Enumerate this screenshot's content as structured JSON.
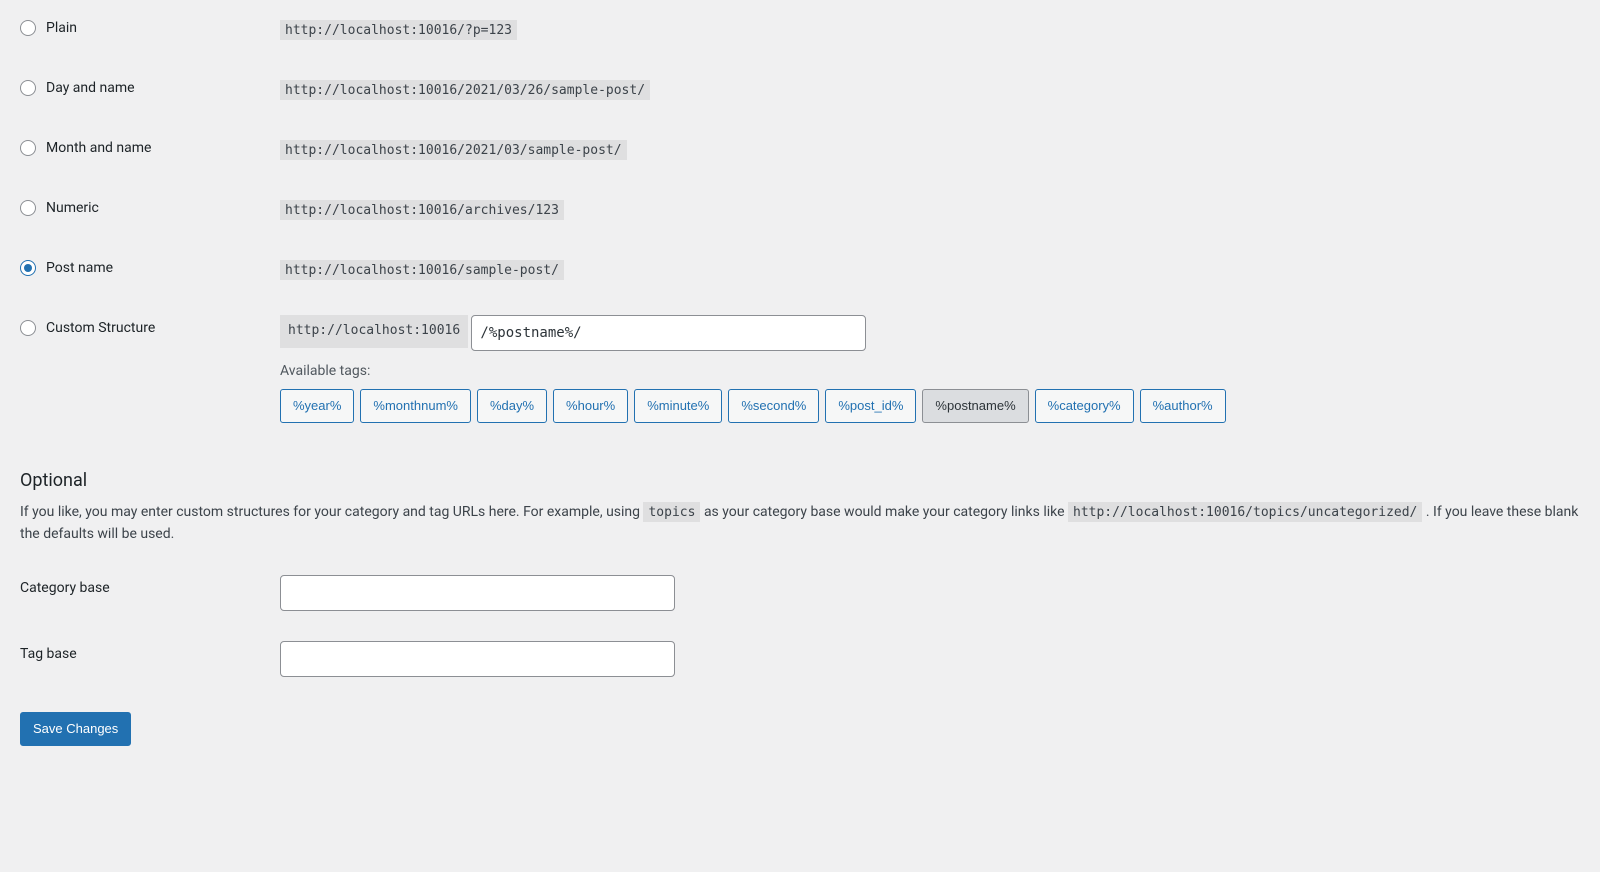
{
  "permalinks": {
    "options": [
      {
        "label": "Plain",
        "example": "http://localhost:10016/?p=123"
      },
      {
        "label": "Day and name",
        "example": "http://localhost:10016/2021/03/26/sample-post/"
      },
      {
        "label": "Month and name",
        "example": "http://localhost:10016/2021/03/sample-post/"
      },
      {
        "label": "Numeric",
        "example": "http://localhost:10016/archives/123"
      },
      {
        "label": "Post name",
        "example": "http://localhost:10016/sample-post/"
      }
    ],
    "selected_index": 4,
    "custom": {
      "label": "Custom Structure",
      "base": "http://localhost:10016",
      "value": "/%postname%/",
      "available_label": "Available tags:",
      "tags": [
        "%year%",
        "%monthnum%",
        "%day%",
        "%hour%",
        "%minute%",
        "%second%",
        "%post_id%",
        "%postname%",
        "%category%",
        "%author%"
      ],
      "active_tag_index": 7
    }
  },
  "optional": {
    "heading": "Optional",
    "desc_pre": "If you like, you may enter custom structures for your category and tag URLs here. For example, using ",
    "desc_code1": "topics",
    "desc_mid": " as your category base would make your category links like ",
    "desc_code2": "http://localhost:10016/topics/uncategorized/",
    "desc_post": " . If you leave these blank the defaults will be used.",
    "category_label": "Category base",
    "category_value": "",
    "tag_label": "Tag base",
    "tag_value": ""
  },
  "save_button": "Save Changes"
}
